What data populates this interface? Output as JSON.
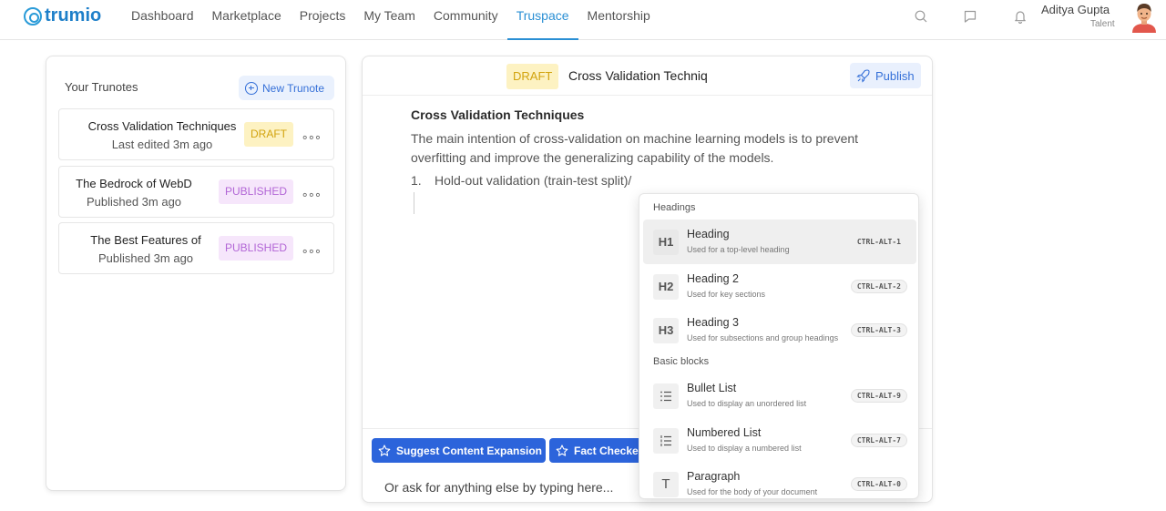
{
  "brand": {
    "name": "trumio",
    "color": "#1e7fc9"
  },
  "nav": {
    "items": [
      "Dashboard",
      "Marketplace",
      "Projects",
      "My Team",
      "Community",
      "Truspace",
      "Mentorship"
    ],
    "active": "Truspace",
    "icons": [
      "search-icon",
      "chat-icon",
      "bell-icon"
    ]
  },
  "user": {
    "name": "Aditya Gupta",
    "role": "Talent"
  },
  "sidebar": {
    "title": "Your Trunotes",
    "new_button": "New Trunote",
    "notes": [
      {
        "title": "Cross Validation Techniques",
        "meta": "Last edited 3m ago",
        "status": "DRAFT"
      },
      {
        "title": "The Bedrock of WebD",
        "meta": "Published 3m ago",
        "status": "PUBLISHED"
      },
      {
        "title": "The Best Features of",
        "meta": "Published 3m ago",
        "status": "PUBLISHED"
      }
    ],
    "more_label": "∘∘∘"
  },
  "editor": {
    "status": "DRAFT",
    "title": "Cross Validation Techniques",
    "publish_button": "Publish",
    "content": {
      "heading": "Cross Validation Techniques",
      "paragraph": "The main intention of cross-validation on machine learning models is to prevent overfitting and improve the generalizing capability of the models.",
      "list": [
        {
          "num": "1.",
          "text": "Hold-out validation (train-test split)/"
        }
      ]
    },
    "ai": {
      "suggestions": [
        "Suggest Content Expansion",
        "Fact Checker"
      ],
      "input_placeholder": "Or ask for anything else by typing here..."
    }
  },
  "slash_menu": {
    "sections": [
      {
        "title": "Headings",
        "items": [
          {
            "icon": "H1",
            "label": "Heading",
            "desc": "Used for a top-level heading",
            "shortcut": "CTRL-ALT-1",
            "active": true
          },
          {
            "icon": "H2",
            "label": "Heading 2",
            "desc": "Used for key sections",
            "shortcut": "CTRL-ALT-2"
          },
          {
            "icon": "H3",
            "label": "Heading 3",
            "desc": "Used for subsections and group headings",
            "shortcut": "CTRL-ALT-3"
          }
        ]
      },
      {
        "title": "Basic blocks",
        "items": [
          {
            "icon": "bullet-list-icon",
            "label": "Bullet List",
            "desc": "Used to display an unordered list",
            "shortcut": "CTRL-ALT-9"
          },
          {
            "icon": "numbered-list-icon",
            "label": "Numbered List",
            "desc": "Used to display a numbered list",
            "shortcut": "CTRL-ALT-7"
          },
          {
            "icon": "T",
            "label": "Paragraph",
            "desc": "Used for the body of your document",
            "shortcut": "CTRL-ALT-0"
          }
        ]
      }
    ]
  }
}
